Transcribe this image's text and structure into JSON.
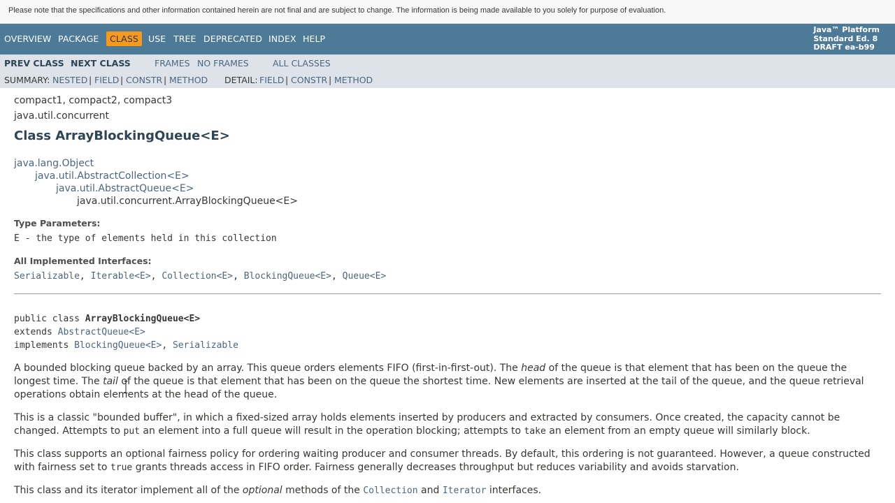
{
  "notice": "Please note that the specifications and other information contained herein are not final and are subject to change. The information is being made available to you solely for purpose of evaluation.",
  "topnav": {
    "overview": "Overview",
    "package": "Package",
    "class": "Class",
    "use": "Use",
    "tree": "Tree",
    "deprecated": "Deprecated",
    "index": "Index",
    "help": "Help",
    "platform_line1": "Java™ Platform",
    "platform_line2": "Standard Ed. 8",
    "platform_line3": "DRAFT ea-b99"
  },
  "subnav": {
    "prev_class": "Prev Class",
    "next_class": "Next Class",
    "frames": "Frames",
    "no_frames": "No Frames",
    "all_classes": "All Classes",
    "summary_label": "Summary:",
    "summary_nested": "Nested",
    "summary_field": "Field",
    "summary_constr": "Constr",
    "summary_method": "Method",
    "detail_label": "Detail:",
    "detail_field": "Field",
    "detail_constr": "Constr",
    "detail_method": "Method",
    "separator": "|"
  },
  "header": {
    "profiles": "compact1, compact2, compact3",
    "package": "java.util.concurrent",
    "title": "Class ArrayBlockingQueue<E>"
  },
  "inheritance": [
    "java.lang.Object",
    "java.util.AbstractCollection<E>",
    "java.util.AbstractQueue<E>",
    "java.util.concurrent.ArrayBlockingQueue<E>"
  ],
  "type_params": {
    "label": "Type Parameters:",
    "value": "E - the type of elements held in this collection"
  },
  "interfaces": {
    "label": "All Implemented Interfaces:",
    "items": [
      "Serializable",
      "Iterable<E>",
      "Collection<E>",
      "BlockingQueue<E>",
      "Queue<E>"
    ],
    "separator": ", "
  },
  "signature": {
    "line1_prefix": "public class ",
    "line1_name": "ArrayBlockingQueue<E>",
    "line2_prefix": "extends ",
    "line2_link": "AbstractQueue<E>",
    "line3_prefix": "implements ",
    "line3_link1": "BlockingQueue<E>",
    "line3_sep": ", ",
    "line3_link2": "Serializable"
  },
  "description": {
    "p1_a": "A bounded blocking queue backed by an array. This queue orders elements FIFO (first-in-first-out). The ",
    "p1_head": "head",
    "p1_b": " of the queue is that element that has been on the queue the longest time. The ",
    "p1_tail": "tail",
    "p1_c": " of the queue is that element that has been on the queue the shortest time. New elements are inserted at the tail of the queue, and the queue retrieval operations obtain elements at the head of the queue.",
    "p2_a": "This is a classic \"bounded buffer\", in which a fixed-sized array holds elements inserted by producers and extracted by consumers. Once created, the capacity cannot be changed. Attempts to ",
    "p2_put": "put",
    "p2_b": " an element into a full queue will result in the operation blocking; attempts to ",
    "p2_take": "take",
    "p2_c": " an element from an empty queue will similarly block.",
    "p3_a": "This class supports an optional fairness policy for ordering waiting producer and consumer threads. By default, this ordering is not guaranteed. However, a queue constructed with fairness set to ",
    "p3_true": "true",
    "p3_b": " grants threads access in FIFO order. Fairness generally decreases throughput but reduces variability and avoids starvation.",
    "p4_a": "This class and its iterator implement all of the ",
    "p4_optional": "optional",
    "p4_b": " methods of the ",
    "p4_collection": "Collection",
    "p4_c": " and ",
    "p4_iterator": "Iterator",
    "p4_d": " interfaces."
  }
}
